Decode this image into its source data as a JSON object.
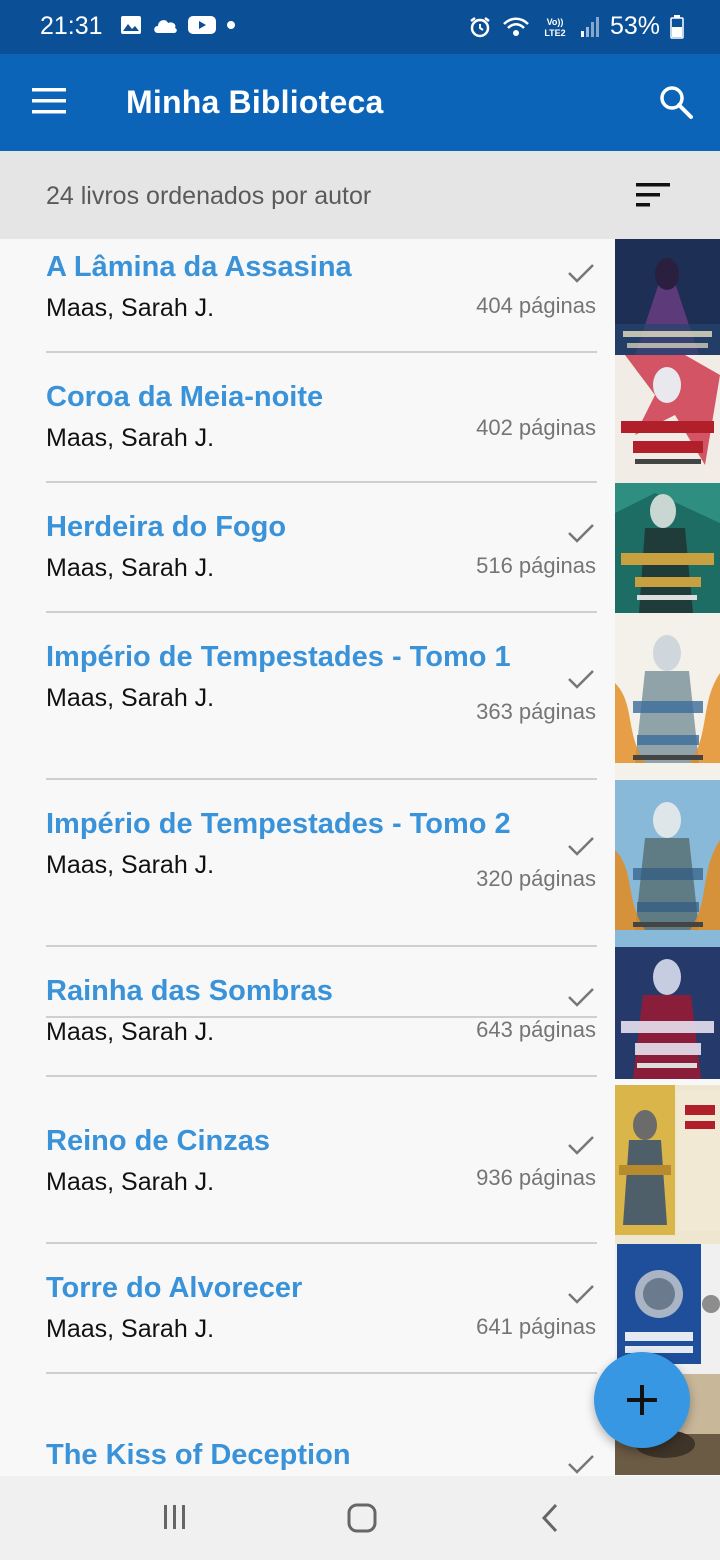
{
  "status_bar": {
    "time": "21:31",
    "battery": "53%",
    "icons": [
      "image-icon",
      "cloud-icon",
      "youtube-icon",
      "dot-icon",
      "alarm-icon",
      "wifi-icon",
      "volte-icon",
      "signal-icon",
      "battery-icon"
    ]
  },
  "app_bar": {
    "title": "Minha Biblioteca",
    "menu_icon": "menu-icon",
    "search_icon": "search-icon",
    "color": "#0b64b8"
  },
  "sort_bar": {
    "label": "24 livros ordenados por autor",
    "icon": "sort-icon"
  },
  "accent_color": "#3a93d9",
  "books": [
    {
      "title": "A Lâmina da Assasina",
      "author": "Maas, Sarah J.",
      "pages": "404 páginas",
      "read": true
    },
    {
      "title": "Coroa da Meia-noite",
      "author": "Maas, Sarah J.",
      "pages": "402 páginas",
      "read": false
    },
    {
      "title": "Herdeira do Fogo",
      "author": "Maas, Sarah J.",
      "pages": "516 páginas",
      "read": true
    },
    {
      "title": "Império de Tempestades - Tomo 1",
      "author": "Maas, Sarah J.",
      "pages": "363 páginas",
      "read": true
    },
    {
      "title": "Império de Tempestades - Tomo 2",
      "author": "Maas, Sarah J.",
      "pages": "320 páginas",
      "read": true
    },
    {
      "title": "Rainha das Sombras",
      "author": "Maas, Sarah J.",
      "pages": "643 páginas",
      "read": true
    },
    {
      "title": "Reino de Cinzas",
      "author": "Maas, Sarah J.",
      "pages": "936 páginas",
      "read": true
    },
    {
      "title": "Torre do Alvorecer",
      "author": "Maas, Sarah J.",
      "pages": "641 páginas",
      "read": true
    },
    {
      "title": "The Kiss of Deception",
      "author": "",
      "pages": "",
      "read": true
    }
  ],
  "fab": {
    "icon": "add-icon"
  },
  "nav_bar": {
    "icons": [
      "recent-apps-icon",
      "home-icon",
      "back-icon"
    ]
  }
}
